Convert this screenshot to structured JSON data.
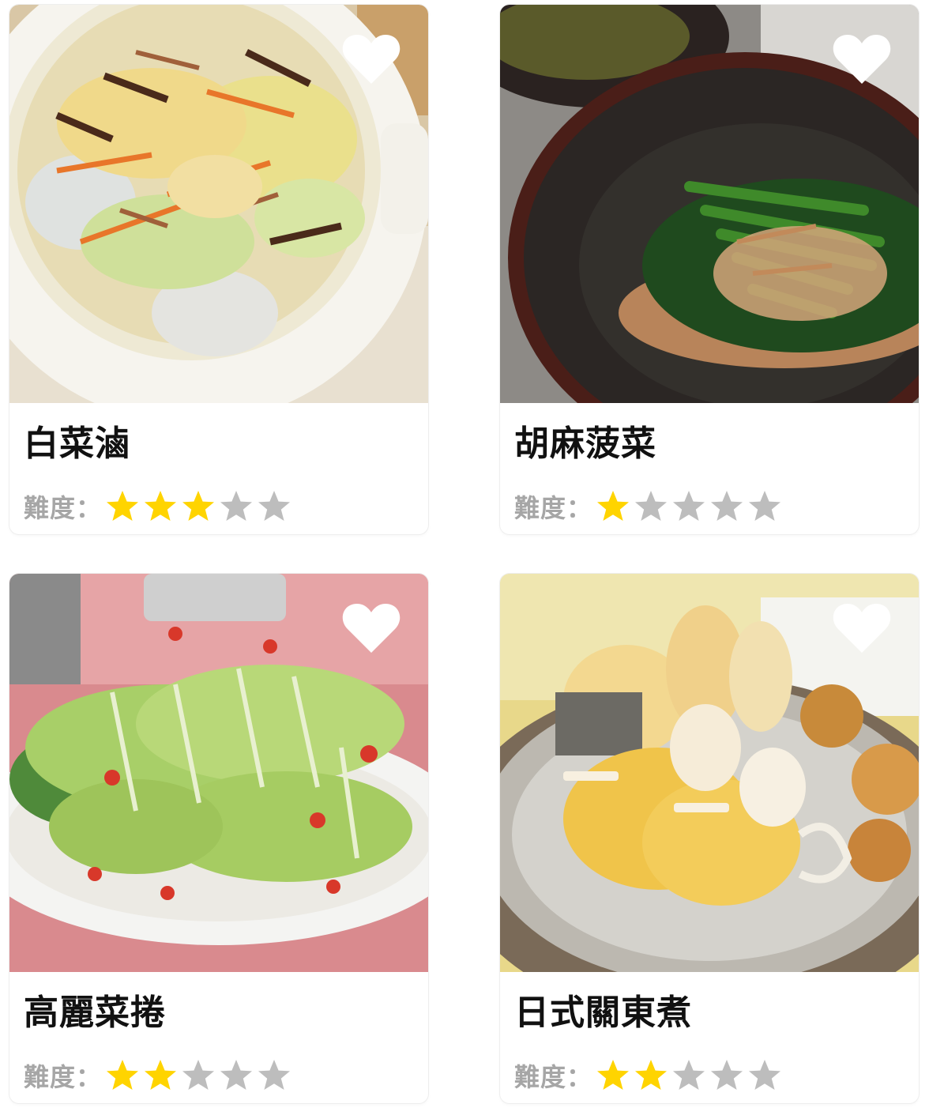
{
  "colors": {
    "star_filled": "#ffd400",
    "star_empty": "#bdbdbd",
    "heart": "#ffffff",
    "label": "#a6a6a6",
    "title": "#111111"
  },
  "recipes": [
    {
      "title": "白菜滷",
      "difficulty_label": "難度：",
      "difficulty": 3,
      "difficulty_max": 5,
      "favorite_icon": "heart-icon",
      "image_alt": "braised napa cabbage in white pot"
    },
    {
      "title": "胡麻菠菜",
      "difficulty_label": "難度：",
      "difficulty": 1,
      "difficulty_max": 5,
      "favorite_icon": "heart-icon",
      "image_alt": "spinach with sesame sauce in dark bowl"
    },
    {
      "title": "高麗菜捲",
      "difficulty_label": "難度：",
      "difficulty": 2,
      "difficulty_max": 5,
      "favorite_icon": "heart-icon",
      "image_alt": "cabbage rolls with goji berries"
    },
    {
      "title": "日式關東煮",
      "difficulty_label": "難度：",
      "difficulty": 2,
      "difficulty_max": 5,
      "favorite_icon": "heart-icon",
      "image_alt": "japanese oden hot pot"
    }
  ]
}
